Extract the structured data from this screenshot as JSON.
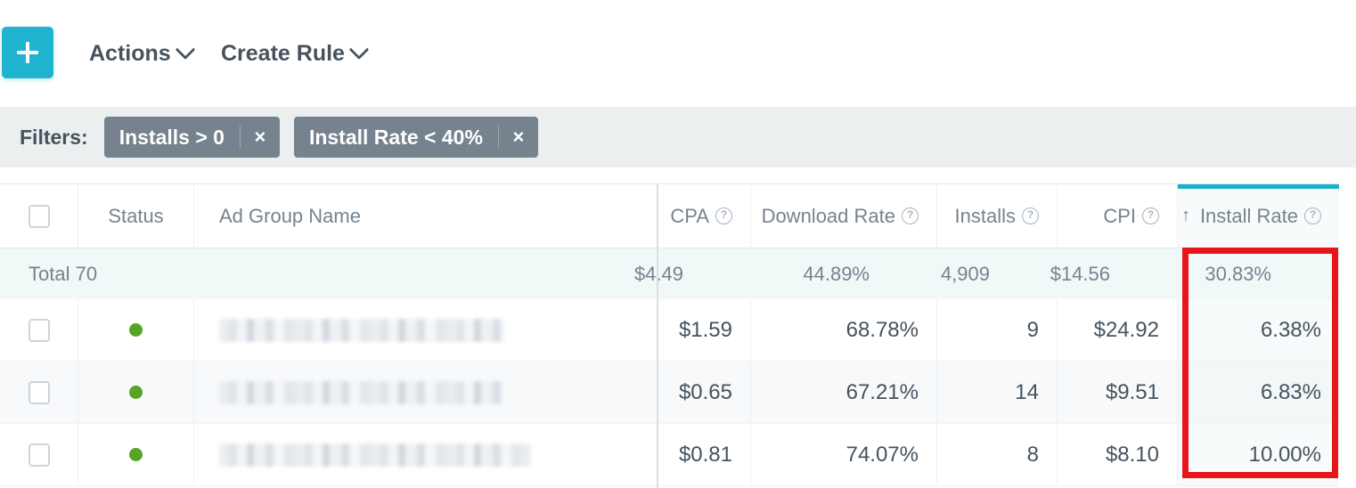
{
  "toolbar": {
    "add_button_icon": "plus-icon",
    "actions_label": "Actions",
    "create_rule_label": "Create Rule",
    "caret_icon": "chevron-down-icon"
  },
  "filters": {
    "label": "Filters:",
    "remove_icon": "close-icon",
    "chips": [
      {
        "label": "Installs > 0",
        "remove": "×"
      },
      {
        "label": "Install Rate < 40%",
        "remove": "×"
      }
    ]
  },
  "table": {
    "sort": {
      "column": "Install Rate",
      "direction": "asc",
      "arrow": "↑",
      "accent_color": "#18b0cc"
    },
    "help_icon_glyph": "?",
    "columns": [
      {
        "key": "checkbox",
        "label": "",
        "help": false
      },
      {
        "key": "status",
        "label": "Status",
        "help": false
      },
      {
        "key": "ad_group_name",
        "label": "Ad Group Name",
        "help": false
      },
      {
        "key": "cpa",
        "label": "CPA",
        "help": true
      },
      {
        "key": "download_rate",
        "label": "Download Rate",
        "help": true
      },
      {
        "key": "installs",
        "label": "Installs",
        "help": true
      },
      {
        "key": "cpi",
        "label": "CPI",
        "help": true
      },
      {
        "key": "install_rate",
        "label": "Install Rate",
        "help": true
      }
    ],
    "total_row": {
      "label": "Total 70",
      "cpa": "$4.49",
      "download_rate": "44.89%",
      "installs": "4,909",
      "cpi": "$14.56",
      "install_rate": "30.83%"
    },
    "rows": [
      {
        "status": "active",
        "status_color": "#56a524",
        "ad_group_name": "",
        "cpa": "$1.59",
        "download_rate": "68.78%",
        "installs": "9",
        "cpi": "$24.92",
        "install_rate": "6.38%"
      },
      {
        "status": "active",
        "status_color": "#56a524",
        "ad_group_name": "",
        "cpa": "$0.65",
        "download_rate": "67.21%",
        "installs": "14",
        "cpi": "$9.51",
        "install_rate": "6.83%"
      },
      {
        "status": "active",
        "status_color": "#56a524",
        "ad_group_name": "",
        "cpa": "$0.81",
        "download_rate": "74.07%",
        "installs": "8",
        "cpi": "$8.10",
        "install_rate": "10.00%"
      }
    ]
  },
  "annotation": {
    "shape": "rectangle-highlight",
    "color": "#e8151a",
    "target_column": "Install Rate"
  },
  "colors": {
    "accent_teal": "#1eb4d0",
    "chip_slate": "#76838f",
    "status_green": "#56a524",
    "annotation_red": "#e8151a"
  }
}
